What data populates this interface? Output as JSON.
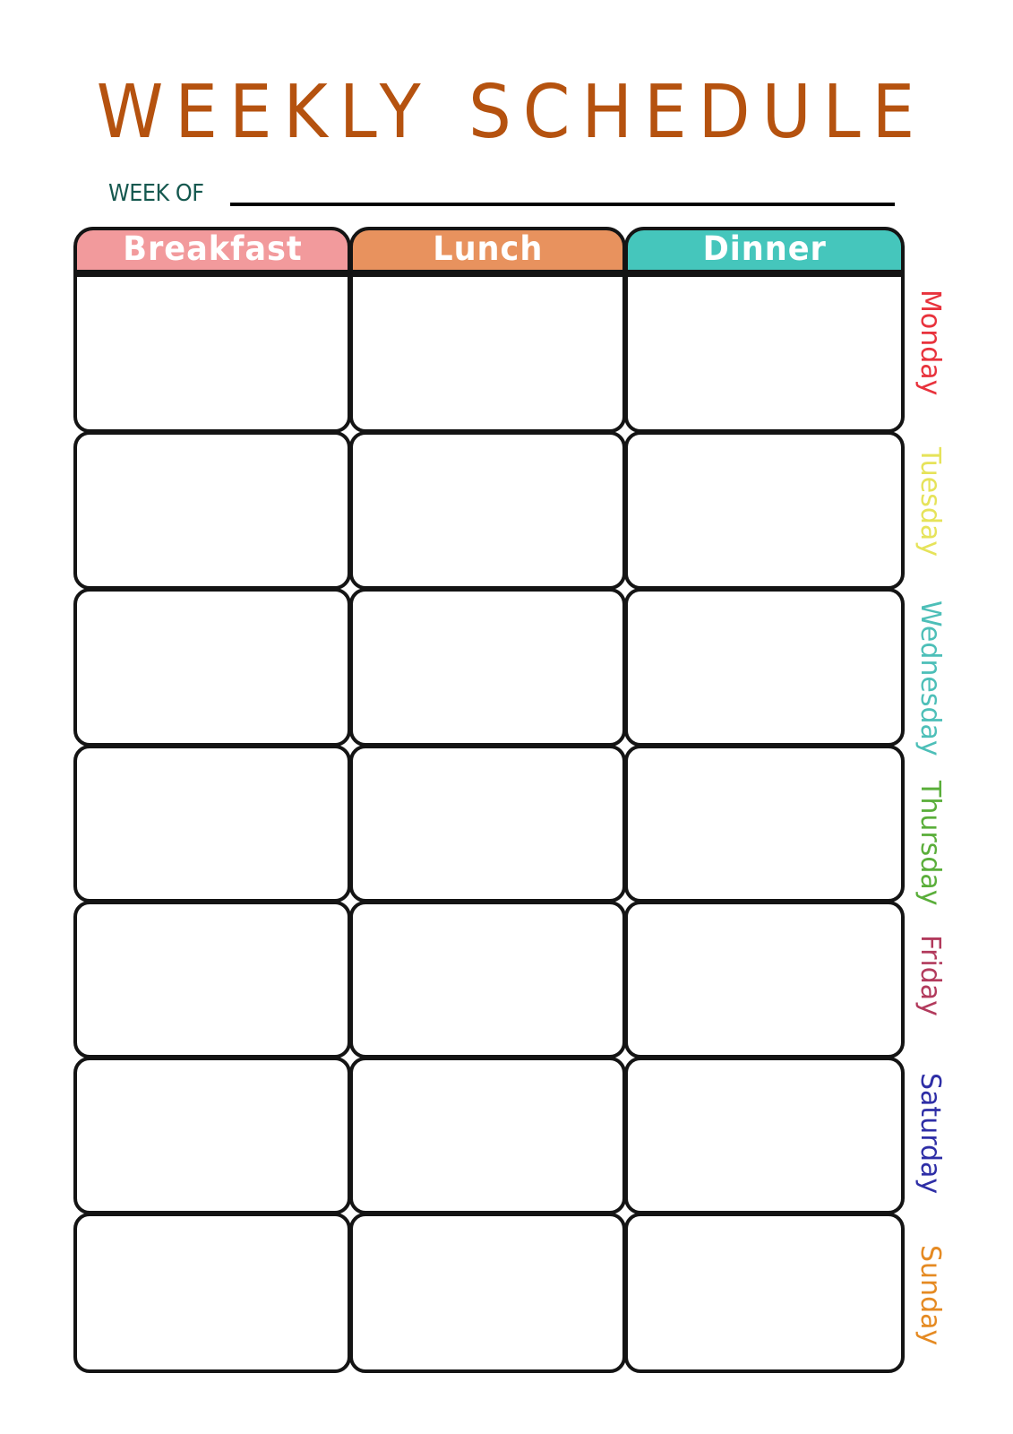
{
  "page": {
    "title_words": [
      "WEEKLY",
      "SCHEDULE"
    ],
    "week_of_label": "WEEK OF",
    "week_of_value": "",
    "colors": {
      "title": "#B5520F",
      "week_of": "#15584F",
      "border": "#141414"
    }
  },
  "meals": [
    {
      "label": "Breakfast",
      "color": "#F29A9C"
    },
    {
      "label": "Lunch",
      "color": "#E8925E"
    },
    {
      "label": "Dinner",
      "color": "#45C6BC"
    }
  ],
  "days": [
    {
      "label": "Monday",
      "color": "#E8323C",
      "entries": [
        "",
        "",
        ""
      ]
    },
    {
      "label": "Tuesday",
      "color": "#E6E35A",
      "entries": [
        "",
        "",
        ""
      ]
    },
    {
      "label": "Wednesday",
      "color": "#4DBFB8",
      "entries": [
        "",
        "",
        ""
      ]
    },
    {
      "label": "Thursday",
      "color": "#5AAE3A",
      "entries": [
        "",
        "",
        ""
      ]
    },
    {
      "label": "Friday",
      "color": "#B23A5C",
      "entries": [
        "",
        "",
        ""
      ]
    },
    {
      "label": "Saturday",
      "color": "#2E2EA6",
      "entries": [
        "",
        "",
        ""
      ]
    },
    {
      "label": "Sunday",
      "color": "#E58A22",
      "entries": [
        "",
        "",
        ""
      ]
    }
  ]
}
